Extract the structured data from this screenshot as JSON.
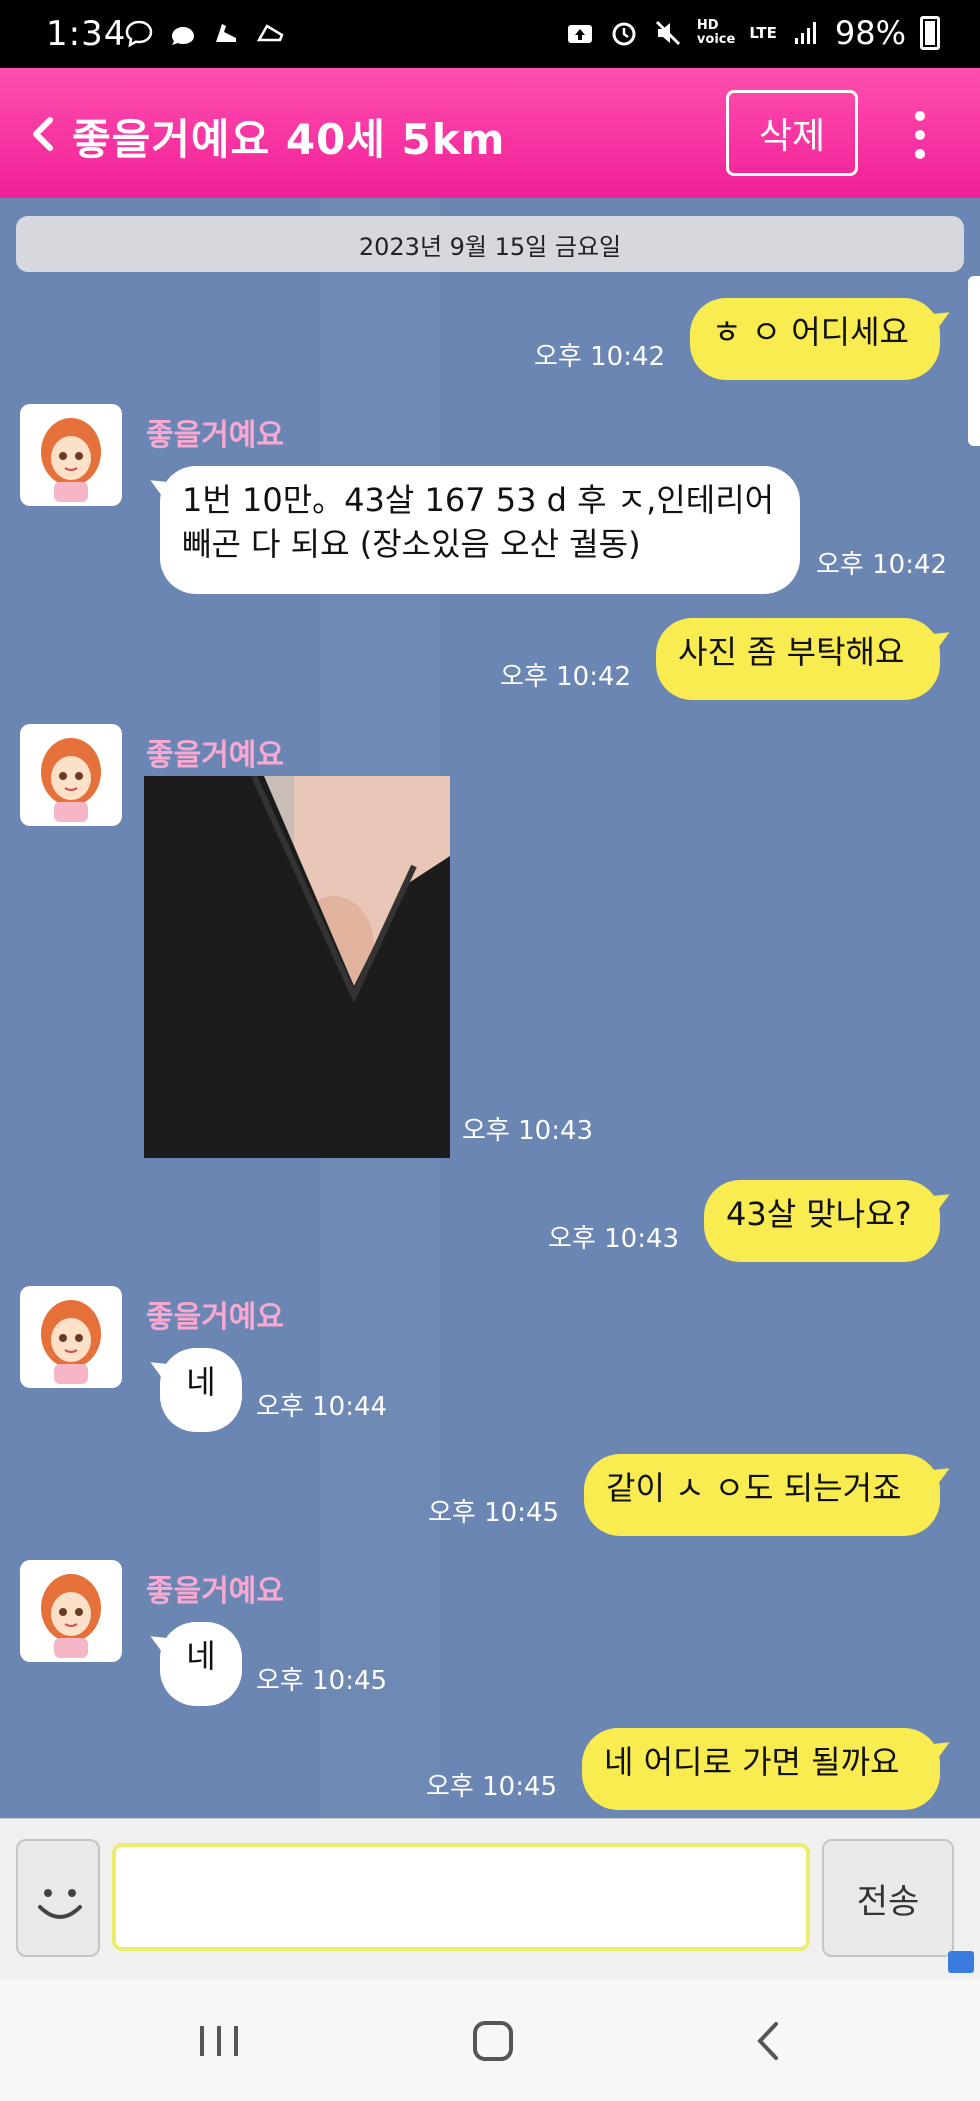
{
  "status_bar": {
    "time": "1:34",
    "net_hd": "HD",
    "net_voice": "voice",
    "net_lte": "LTE",
    "battery": "98%"
  },
  "header": {
    "title": "좋을거예요 40세 5km",
    "delete_label": "삭제"
  },
  "chat": {
    "date": "2023년 9월 15일 금요일",
    "sender_name": "좋을거예요",
    "messages": [
      {
        "from": "me",
        "text": "ㅎ ㅇ 어디세요",
        "time": "오후 10:42"
      },
      {
        "from": "them",
        "text": "1번 10만。43살 167 53 d 후 ㅈ,인테리어\n빼곤 다 되요 (장소있음 오산 궐동)",
        "time": "오후 10:42"
      },
      {
        "from": "me",
        "text": "사진 좀 부탁해요",
        "time": "오후 10:42"
      },
      {
        "from": "them",
        "text": "",
        "time": "오후 10:43"
      },
      {
        "from": "me",
        "text": "43살 맞나요?",
        "time": "오후 10:43"
      },
      {
        "from": "them",
        "text": "네",
        "time": "오후 10:44"
      },
      {
        "from": "me",
        "text": "같이 ㅅ ㅇ도 되는거죠",
        "time": "오후 10:45"
      },
      {
        "from": "them",
        "text": "네",
        "time": "오후 10:45"
      },
      {
        "from": "me",
        "text": "네 어디로 가면 될까요",
        "time": "오후 10:45"
      }
    ]
  },
  "input": {
    "value": "",
    "placeholder": "",
    "send_label": "전송"
  },
  "icons": {
    "back": "chevron-left-icon",
    "more": "vertical-dots-icon",
    "emoji": "smiley-icon"
  },
  "colors": {
    "header": "#f11f96",
    "my_bubble": "#f8ec50",
    "their_bubble": "#ffffff",
    "chat_bg": "#6b86b3",
    "sender_name": "#f7a9d2"
  }
}
